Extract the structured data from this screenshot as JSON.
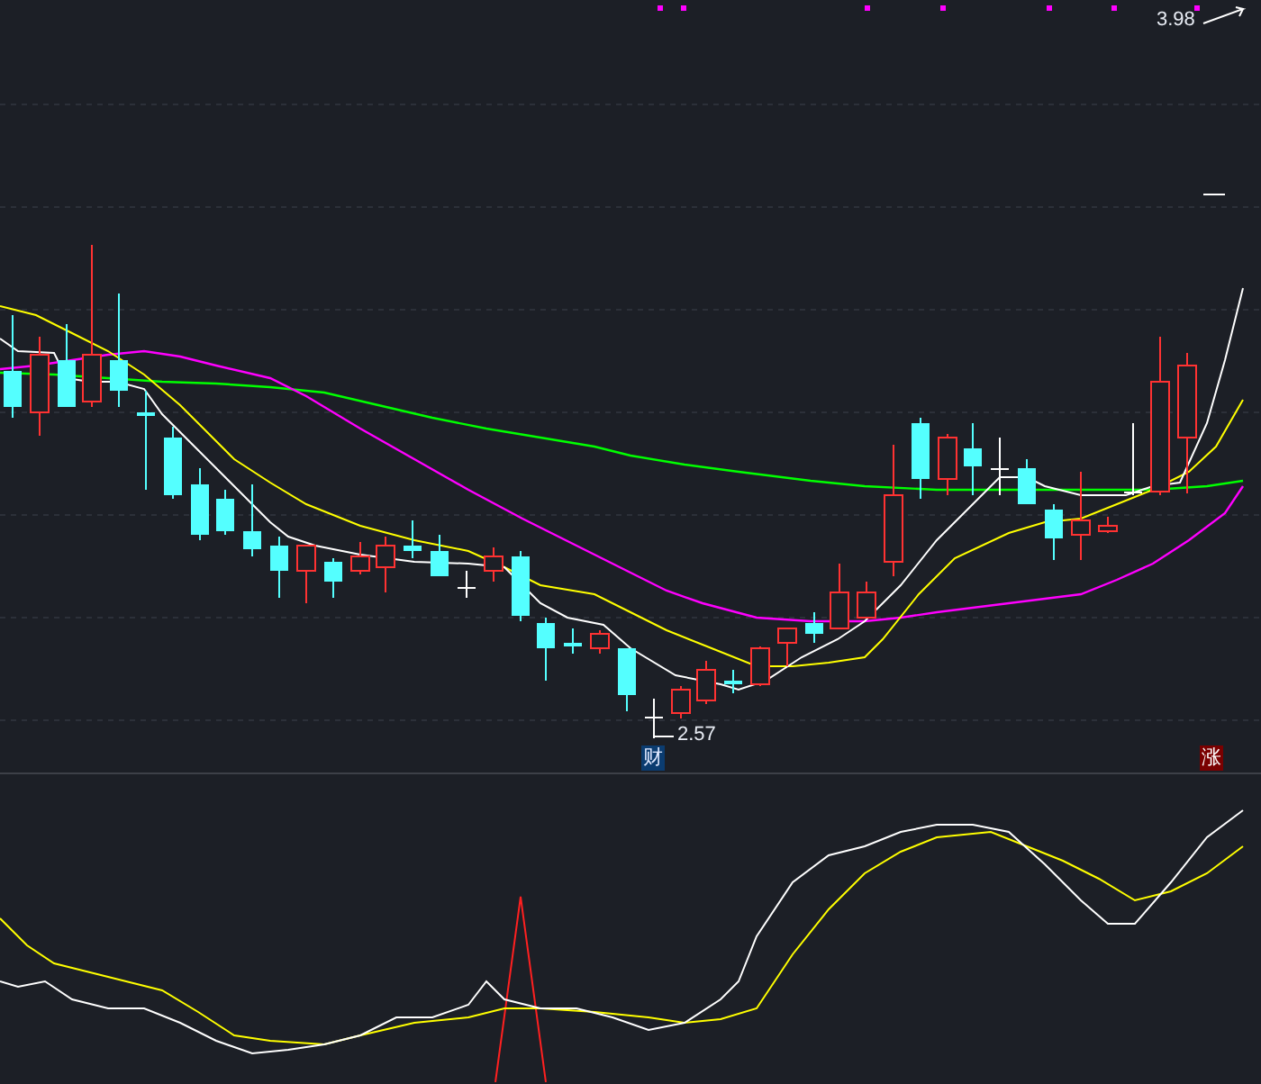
{
  "price_chart": {
    "high_label": "3.98",
    "low_label": "2.57",
    "badges": [
      {
        "text": "财",
        "kind": "finance"
      },
      {
        "text": "涨",
        "kind": "rise"
      }
    ]
  }
}
